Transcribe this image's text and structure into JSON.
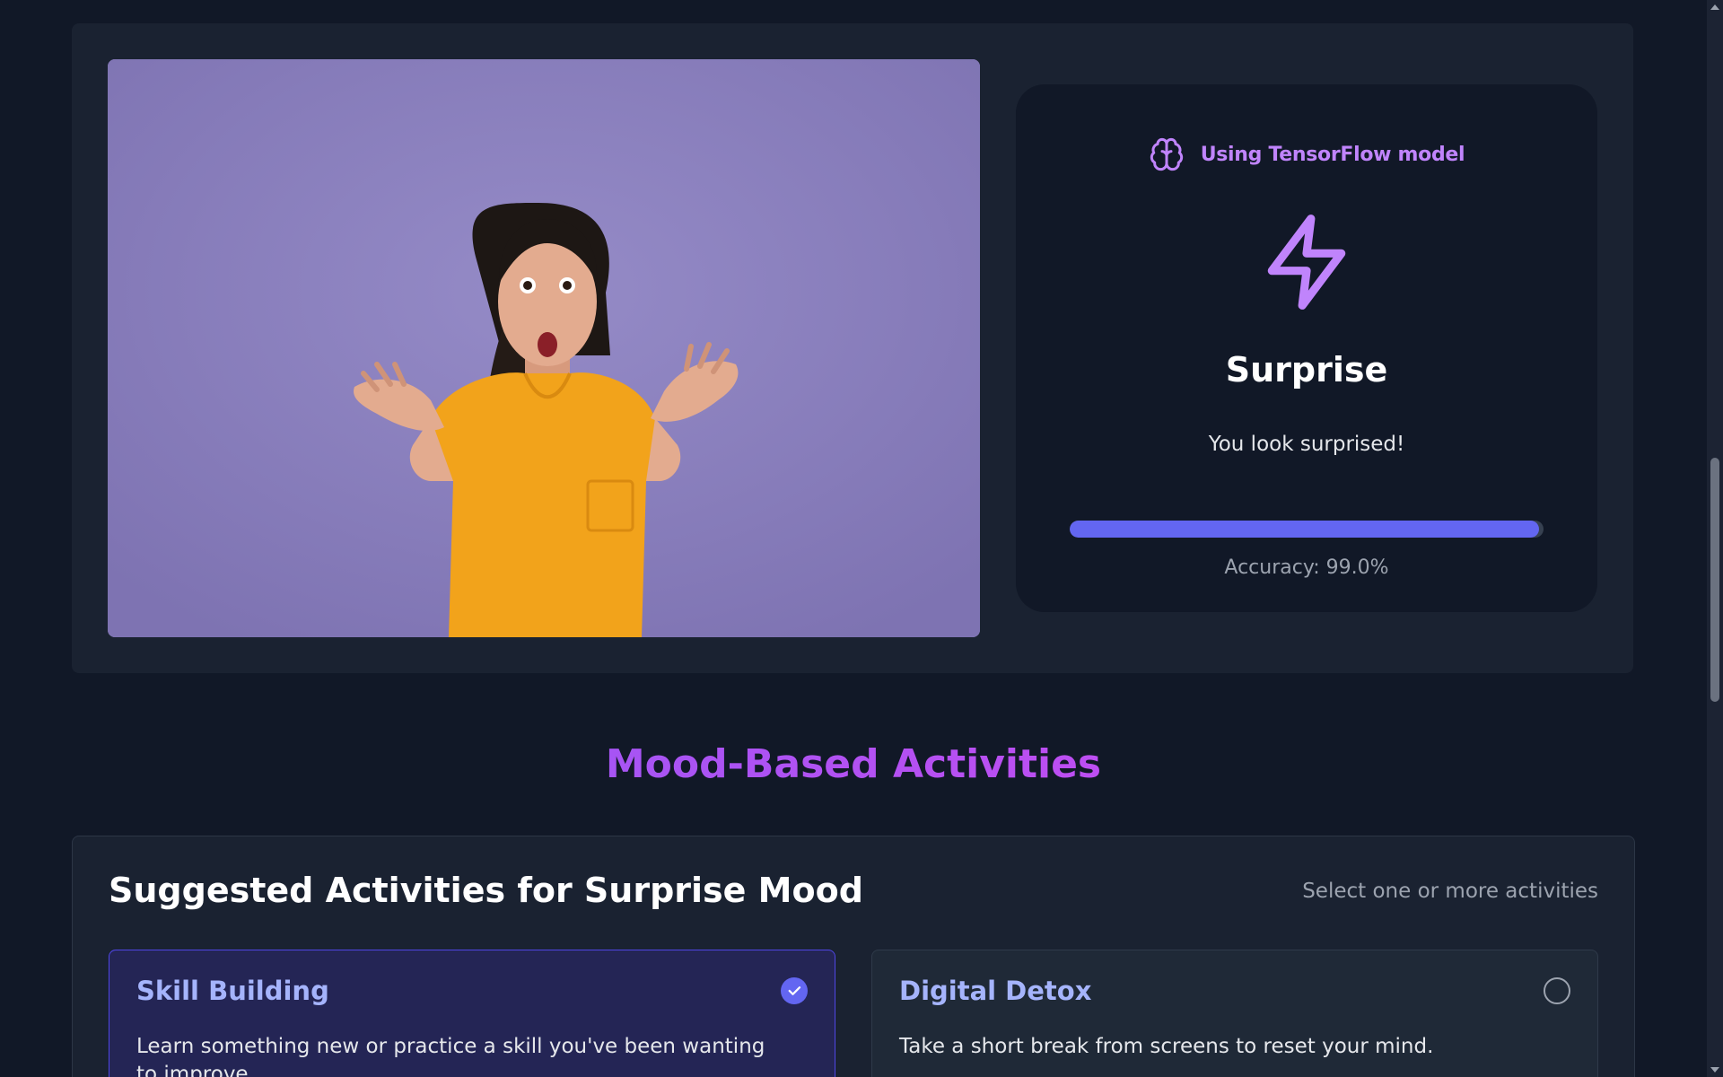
{
  "analysis": {
    "photo_alt": "Surprised woman in yellow shirt",
    "model_label": "Using TensorFlow model",
    "model_icon": "brain-icon",
    "emotion_icon": "lightning-bolt-icon",
    "emotion": "Surprise",
    "message": "You look surprised!",
    "accuracy_fraction": 0.99,
    "accuracy_text": "Accuracy: 99.0%"
  },
  "section_title": "Mood-Based Activities",
  "activities": {
    "title": "Suggested Activities for Surprise Mood",
    "hint": "Select one or more activities",
    "items": [
      {
        "name": "Skill Building",
        "description": "Learn something new or practice a skill you've been wanting to improve.",
        "selected": true
      },
      {
        "name": "Digital Detox",
        "description": "Take a short break from screens to reset your mind.",
        "selected": false
      }
    ]
  },
  "colors": {
    "accent": "#6366f1",
    "purple": "#c084fc",
    "background": "#111827",
    "card": "#1a2231"
  }
}
